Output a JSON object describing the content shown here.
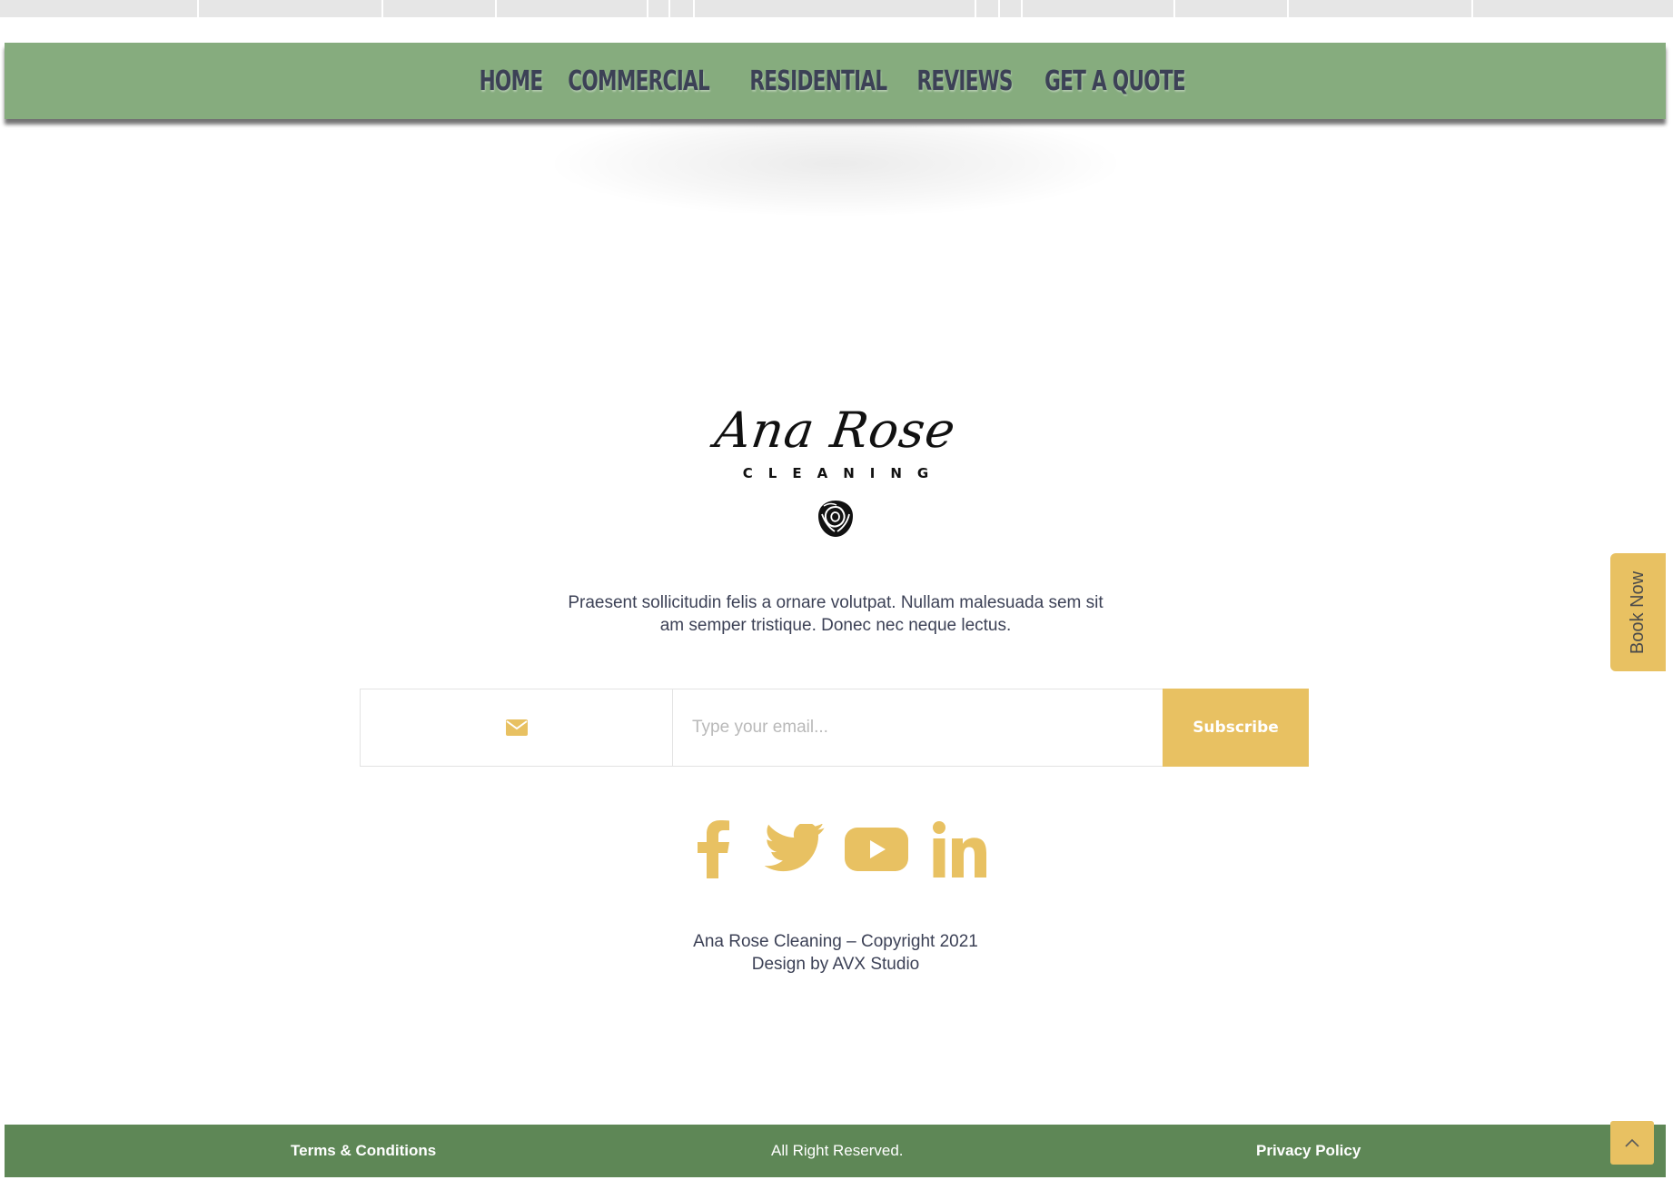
{
  "nav": {
    "items": [
      "HOME",
      "COMMERCIAL",
      "RESIDENTIAL",
      "REVIEWS",
      "GET A QUOTE"
    ]
  },
  "logo": {
    "script": "Ana Rose",
    "subtitle": "CLEANING",
    "icon": "rose-icon"
  },
  "description": {
    "line1": "Praesent sollicitudin felis a ornare volutpat. Nullam malesuada sem sit",
    "line2": "am semper tristique. Donec nec neque lectus."
  },
  "subscribe": {
    "icon": "envelope-icon",
    "placeholder": "Type your email...",
    "button_label": "Subscribe"
  },
  "social": {
    "icons": [
      "facebook-icon",
      "twitter-icon",
      "youtube-icon",
      "linkedin-icon"
    ],
    "color": "#e8c162"
  },
  "copyright": {
    "line1": "Ana Rose Cleaning – Copyright 2021",
    "line2": "Design by AVX Studio"
  },
  "book_now": {
    "label": "Book Now"
  },
  "footer": {
    "terms": "Terms & Conditions",
    "rights": "All Right Reserved.",
    "privacy": "Privacy Policy"
  },
  "back_to_top": {
    "icon": "chevron-up-icon"
  },
  "colors": {
    "nav_green": "#86ac7e",
    "footer_green": "#5e8756",
    "accent_gold": "#e8c162",
    "text_dark": "#3c4156"
  }
}
